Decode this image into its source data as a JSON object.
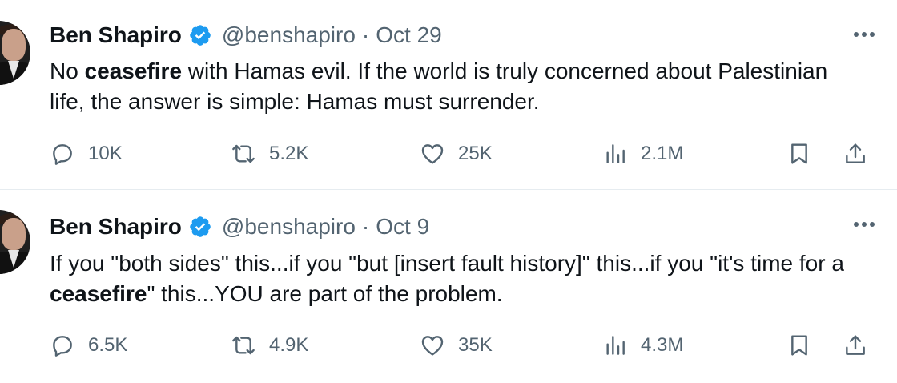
{
  "tweets": [
    {
      "author": "Ben Shapiro",
      "handle": "@benshapiro",
      "separator": "·",
      "date": "Oct 29",
      "text_segments": [
        {
          "t": "No ",
          "bold": false
        },
        {
          "t": "ceasefire",
          "bold": true
        },
        {
          "t": " with Hamas evil. If the world is truly concerned about Palestinian life, the answer is simple: Hamas must surrender.",
          "bold": false
        }
      ],
      "replies": "10K",
      "reposts": "5.2K",
      "likes": "25K",
      "views": "2.1M"
    },
    {
      "author": "Ben Shapiro",
      "handle": "@benshapiro",
      "separator": "·",
      "date": "Oct 9",
      "text_segments": [
        {
          "t": "If you \"both sides\" this...if you \"but [insert fault history]\" this...if you \"it's time for a ",
          "bold": false
        },
        {
          "t": "ceasefire",
          "bold": true
        },
        {
          "t": "\" this...YOU are part of the problem.",
          "bold": false
        }
      ],
      "replies": "6.5K",
      "reposts": "4.9K",
      "likes": "35K",
      "views": "4.3M"
    }
  ],
  "icons": {
    "verified": "verified-badge-icon",
    "more": "more-dots-icon",
    "reply": "reply-icon",
    "repost": "repost-icon",
    "like": "heart-icon",
    "views": "analytics-icon",
    "bookmark": "bookmark-icon",
    "share": "share-icon"
  },
  "colors": {
    "text": "#0f1419",
    "secondary": "#536471",
    "verified": "#1d9bf0",
    "divider": "#e6ecf0"
  }
}
